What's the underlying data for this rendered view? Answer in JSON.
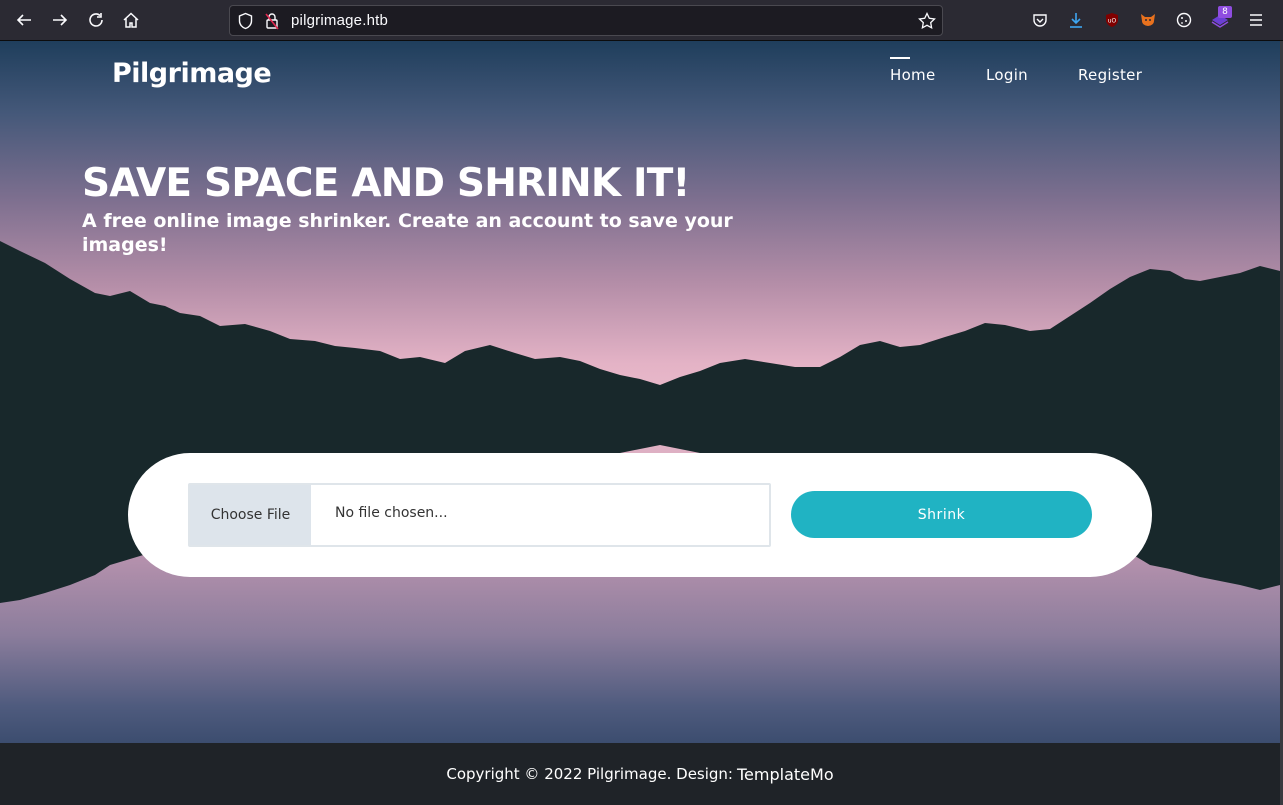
{
  "browser": {
    "url": "pilgrimage.htb",
    "extension_badge": "8"
  },
  "header": {
    "brand": "Pilgrimage",
    "nav": [
      {
        "label": "Home",
        "active": true
      },
      {
        "label": "Login",
        "active": false
      },
      {
        "label": "Register",
        "active": false
      }
    ]
  },
  "hero": {
    "title": "SAVE SPACE AND SHRINK IT!",
    "subtitle": "A free online image shrinker. Create an account to save your images!"
  },
  "upload": {
    "choose_label": "Choose File",
    "file_status": "No file chosen...",
    "submit_label": "Shrink"
  },
  "footer": {
    "copyright": "Copyright © 2022 Pilgrimage. Design:",
    "credit": "TemplateMo"
  },
  "colors": {
    "accent": "#20b3c3",
    "mountains": "#18282b",
    "footer_bg": "#1f2328",
    "browser_bg": "#2b2a33"
  }
}
